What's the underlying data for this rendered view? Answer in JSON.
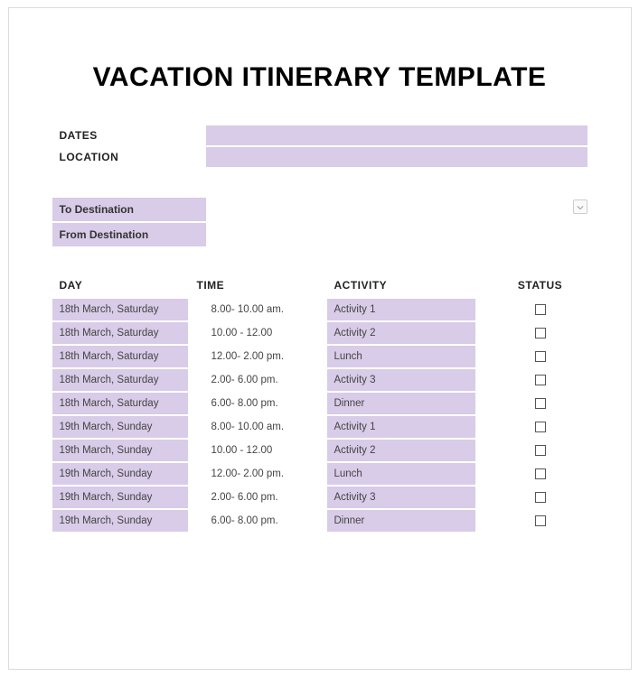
{
  "title": "VACATION ITINERARY TEMPLATE",
  "meta": {
    "dates_label": "DATES",
    "dates_value": "",
    "location_label": "LOCATION",
    "location_value": ""
  },
  "destination": {
    "to_label": "To Destination",
    "from_label": "From Destination"
  },
  "table": {
    "headers": {
      "day": "DAY",
      "time": "TIME",
      "activity": "ACTIVITY",
      "status": "STATUS"
    },
    "rows": [
      {
        "day": "18th March, Saturday",
        "time": "8.00- 10.00 am.",
        "activity": "Activity 1",
        "status": false
      },
      {
        "day": "18th March, Saturday",
        "time": "10.00 - 12.00",
        "activity": "Activity 2",
        "status": false
      },
      {
        "day": "18th March, Saturday",
        "time": "12.00- 2.00 pm.",
        "activity": "Lunch",
        "status": false
      },
      {
        "day": "18th March, Saturday",
        "time": "2.00- 6.00 pm.",
        "activity": "Activity 3",
        "status": false
      },
      {
        "day": "18th March, Saturday",
        "time": "6.00- 8.00 pm.",
        "activity": "Dinner",
        "status": false
      },
      {
        "day": "19th March, Sunday",
        "time": "8.00- 10.00 am.",
        "activity": "Activity 1",
        "status": false
      },
      {
        "day": "19th March, Sunday",
        "time": "10.00 - 12.00",
        "activity": "Activity 2",
        "status": false
      },
      {
        "day": "19th March, Sunday",
        "time": "12.00- 2.00 pm.",
        "activity": "Lunch",
        "status": false
      },
      {
        "day": "19th March, Sunday",
        "time": "2.00- 6.00 pm.",
        "activity": "Activity 3",
        "status": false
      },
      {
        "day": "19th March, Sunday",
        "time": "6.00- 8.00 pm.",
        "activity": "Dinner",
        "status": false
      }
    ]
  }
}
